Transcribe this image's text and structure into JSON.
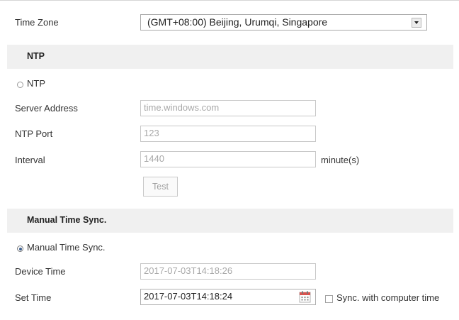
{
  "time_zone": {
    "label": "Time Zone",
    "selected": "(GMT+08:00) Beijing, Urumqi, Singapore"
  },
  "ntp_section": {
    "title": "NTP",
    "radio_label": "NTP",
    "server_address": {
      "label": "Server Address",
      "value": "time.windows.com"
    },
    "ntp_port": {
      "label": "NTP Port",
      "value": "123"
    },
    "interval": {
      "label": "Interval",
      "value": "1440",
      "unit": "minute(s)"
    },
    "test_button": "Test"
  },
  "manual_section": {
    "title": "Manual Time Sync.",
    "radio_label": "Manual Time Sync.",
    "device_time": {
      "label": "Device Time",
      "value": "2017-07-03T14:18:26"
    },
    "set_time": {
      "label": "Set Time",
      "value": "2017-07-03T14:18:24"
    },
    "sync_label": "Sync. with computer time"
  },
  "state": {
    "selected_mode": "manual",
    "sync_with_computer": false
  },
  "colors": {
    "section_bar": "#f0f0f0",
    "radio_dot": "#3d5f8f",
    "calendar_accent": "#d9534f"
  },
  "icons": [
    "chevron-down-icon",
    "calendar-icon"
  ]
}
